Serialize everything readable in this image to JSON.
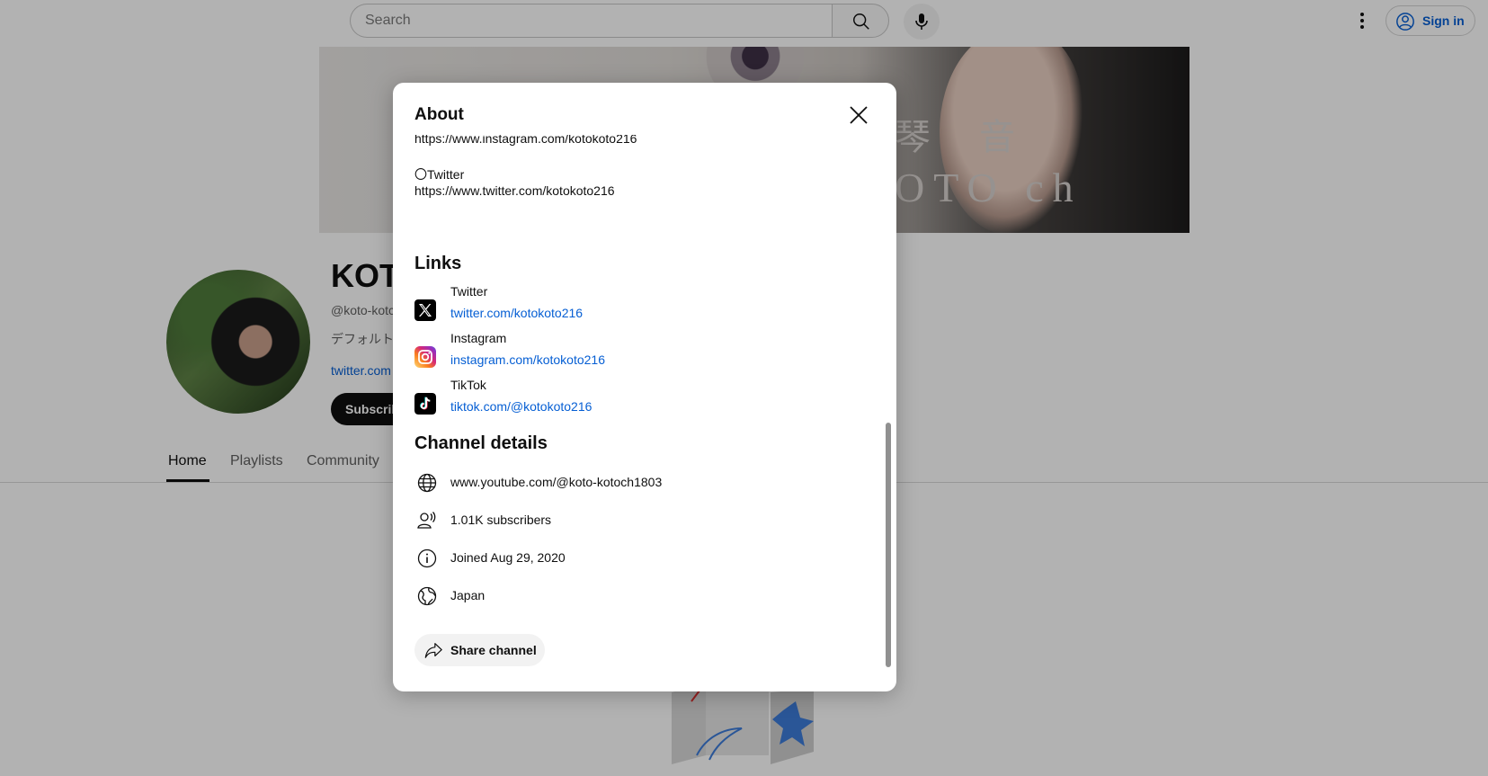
{
  "masthead": {
    "search_placeholder": "Search",
    "signin_label": "Sign in"
  },
  "banner": {
    "title_text": "琴 音",
    "subtitle_text": "OTO ch"
  },
  "channel": {
    "name": "KOT",
    "handle": "@koto-kotc",
    "description": "デフォルト",
    "link": "twitter.com",
    "subscribe_label": "Subscrib"
  },
  "tabs": [
    {
      "label": "Home"
    },
    {
      "label": "Playlists"
    },
    {
      "label": "Community"
    }
  ],
  "dialog": {
    "title": "About",
    "description_lines": [
      "https://www.instagram.com/kotokoto216",
      "〇Twitter",
      "https://www.twitter.com/kotokoto216"
    ],
    "links_heading": "Links",
    "links": [
      {
        "title": "Twitter",
        "url": "twitter.com/kotokoto216",
        "icon": "x-twitter-icon"
      },
      {
        "title": "Instagram",
        "url": "instagram.com/kotokoto216",
        "icon": "instagram-icon"
      },
      {
        "title": "TikTok",
        "url": "tiktok.com/@kotokoto216",
        "icon": "tiktok-icon"
      }
    ],
    "details_heading": "Channel details",
    "details": [
      {
        "text": "www.youtube.com/@koto-kotoch1803",
        "icon": "globe-icon"
      },
      {
        "text": "1.01K subscribers",
        "icon": "subscribers-icon"
      },
      {
        "text": "Joined Aug 29, 2020",
        "icon": "info-icon"
      },
      {
        "text": "Japan",
        "icon": "location-globe-icon"
      }
    ],
    "share_label": "Share channel"
  },
  "colors": {
    "link_blue": "#065fd4",
    "overlay": "rgba(0,0,0,0.30)",
    "subscribe_bg": "#0f0f0f"
  }
}
